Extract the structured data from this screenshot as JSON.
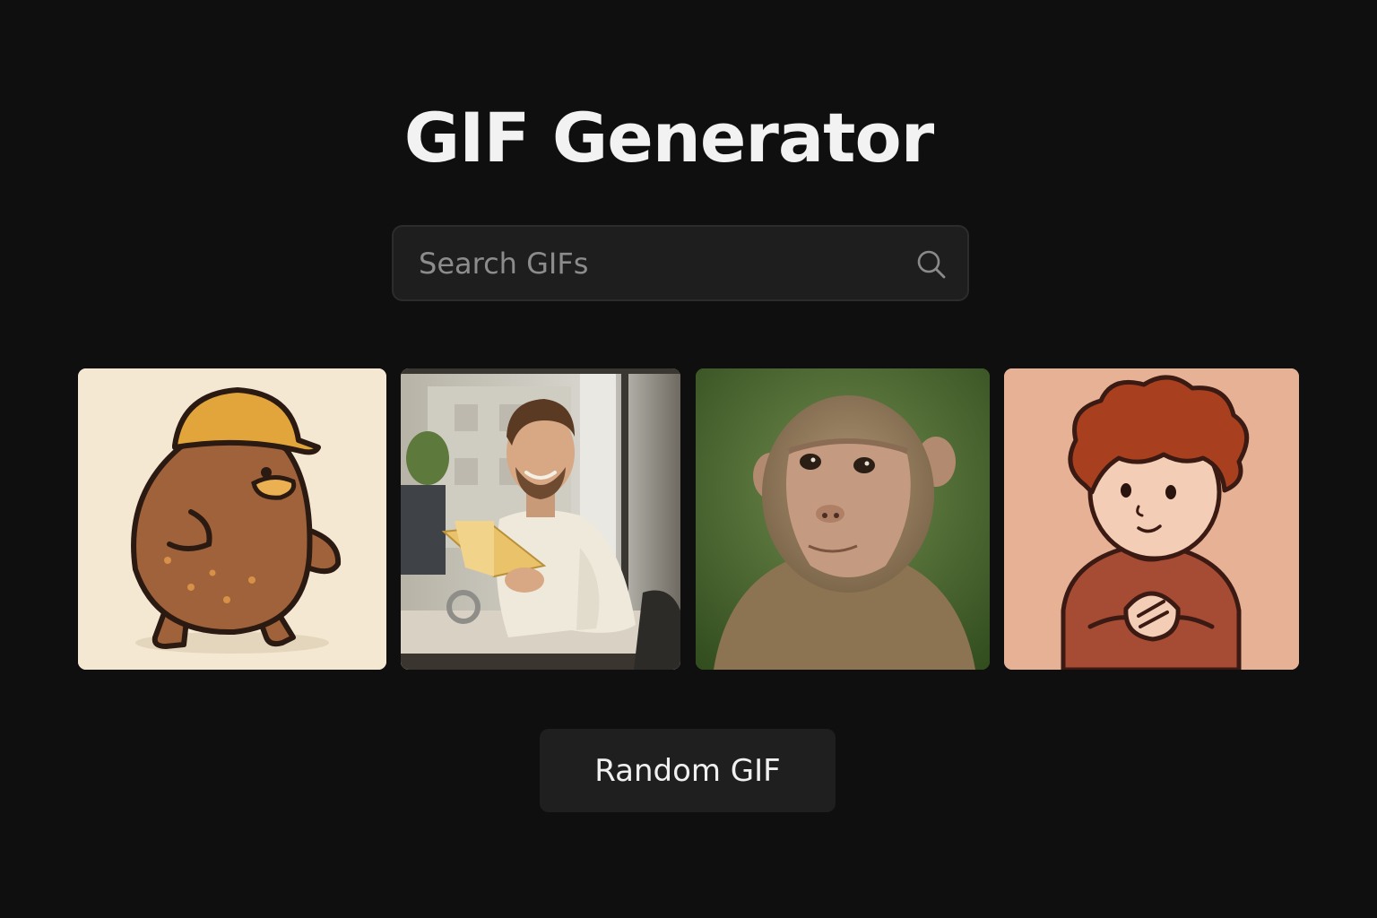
{
  "header": {
    "title": "GIF Generator"
  },
  "search": {
    "placeholder": "Search GIFs",
    "value": "",
    "icon": "search-icon"
  },
  "results": [
    {
      "kind": "cartoon-brown-duck-with-yellow-hardhat"
    },
    {
      "kind": "photo-smiling-man-reading-book-at-desk"
    },
    {
      "kind": "photo-macaque-monkey-face"
    },
    {
      "kind": "cartoon-curly-red-hair-boy-clasping-hands"
    }
  ],
  "actions": {
    "random_label": "Random GIF"
  },
  "colors": {
    "background": "#0f0f0f",
    "surface": "#1e1e1e",
    "text": "#f2f2f2",
    "placeholder": "#8c8c8c"
  }
}
